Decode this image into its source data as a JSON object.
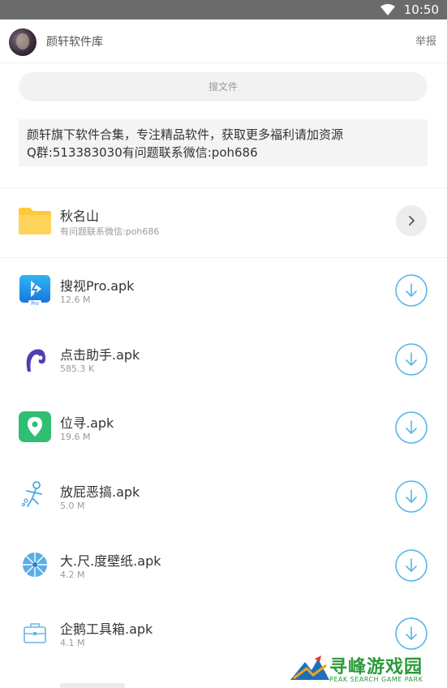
{
  "status_bar": {
    "time": "10:50"
  },
  "header": {
    "title": "颜轩软件库",
    "report_label": "举报"
  },
  "search": {
    "placeholder": "搜文件"
  },
  "notice": {
    "line1": "颜轩旗下软件合集，专注精品软件，获取更多福利请加资源",
    "line2": "Q群:513383030有问题联系微信:poh686"
  },
  "folder": {
    "name": "秋名山",
    "subtitle": "有问题联系微信:poh686",
    "icon": "folder-icon"
  },
  "files": [
    {
      "name": "搜视Pro.apk",
      "size": "12.6 M",
      "icon": "sousi-pro-app-icon"
    },
    {
      "name": "点击助手.apk",
      "size": "585.3 K",
      "icon": "click-assistant-app-icon"
    },
    {
      "name": "位寻.apk",
      "size": "19.6 M",
      "icon": "location-pin-app-icon"
    },
    {
      "name": "放屁恶搞.apk",
      "size": "5.0 M",
      "icon": "prank-figure-app-icon"
    },
    {
      "name": "大.尺.度壁纸.apk",
      "size": "4.2 M",
      "icon": "wallpaper-umbrella-app-icon"
    },
    {
      "name": "企鹅工具箱.apk",
      "size": "4.1 M",
      "icon": "toolbox-briefcase-app-icon"
    }
  ],
  "watermark": {
    "text": "寻峰游戏园",
    "sub": "PEAK SEARCH GAME PARK"
  },
  "colors": {
    "accent": "#5ab6e6",
    "status_bar": "#6b6b6b",
    "folder": "#ffc93c"
  }
}
